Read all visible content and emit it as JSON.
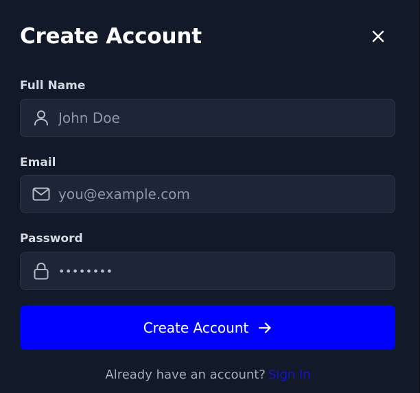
{
  "dialog": {
    "title": "Create Account",
    "close_icon": "close-icon"
  },
  "form": {
    "full_name": {
      "label": "Full Name",
      "placeholder": "John Doe",
      "value": "",
      "icon": "user-icon"
    },
    "email": {
      "label": "Email",
      "placeholder": "you@example.com",
      "value": "",
      "icon": "mail-icon"
    },
    "password": {
      "label": "Password",
      "placeholder": "",
      "value": "password",
      "icon": "lock-icon"
    },
    "submit": {
      "label": "Create Account",
      "icon": "arrow-right-icon"
    }
  },
  "footer": {
    "prompt": "Already have an account?",
    "link_label": "Sign In"
  },
  "colors": {
    "background": "#121a29",
    "input_background": "#1d2636",
    "primary": "#0000ff",
    "link": "#1414c8",
    "label_text": "#d3d8e1",
    "muted_text": "#a7afbc"
  }
}
